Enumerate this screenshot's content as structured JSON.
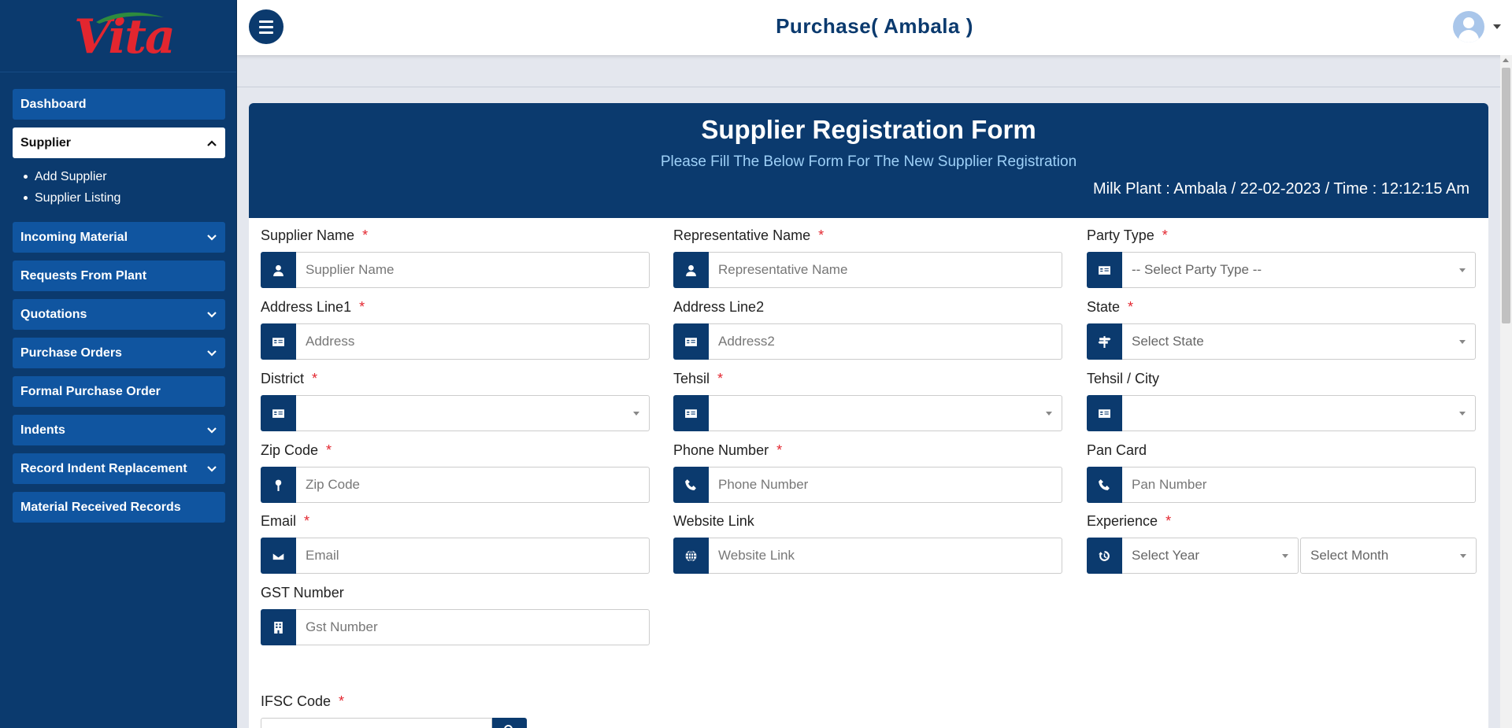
{
  "sidebar": {
    "logo_text": "Vita",
    "items": [
      {
        "label": "Dashboard"
      },
      {
        "label": "Supplier",
        "expanded": true,
        "subitems": [
          {
            "label": "Add Supplier"
          },
          {
            "label": "Supplier Listing"
          }
        ]
      },
      {
        "label": "Incoming Material"
      },
      {
        "label": "Requests From Plant"
      },
      {
        "label": "Quotations"
      },
      {
        "label": "Purchase Orders"
      },
      {
        "label": "Formal Purchase Order"
      },
      {
        "label": "Indents"
      },
      {
        "label": "Record Indent Replacement"
      },
      {
        "label": "Material Received Records"
      }
    ]
  },
  "header": {
    "title": "Purchase( Ambala )"
  },
  "form": {
    "title": "Supplier Registration Form",
    "subtitle": "Please Fill The Below Form For The New Supplier Registration",
    "plant_info": "Milk Plant : Ambala / 22-02-2023 / Time :  12:12:15 Am",
    "required_mark": "*",
    "fields": {
      "supplier_name": {
        "label": "Supplier Name",
        "placeholder": "Supplier Name"
      },
      "representative_name": {
        "label": "Representative Name",
        "placeholder": "Representative Name"
      },
      "party_type": {
        "label": "Party Type",
        "value": "-- Select Party Type --"
      },
      "address1": {
        "label": "Address Line1",
        "placeholder": "Address"
      },
      "address2": {
        "label": "Address Line2",
        "placeholder": "Address2"
      },
      "state": {
        "label": "State",
        "value": "Select State"
      },
      "district": {
        "label": "District",
        "value": ""
      },
      "tehsil": {
        "label": "Tehsil",
        "value": ""
      },
      "tehsil_city": {
        "label": "Tehsil / City",
        "value": ""
      },
      "zip": {
        "label": "Zip Code",
        "placeholder": "Zip Code"
      },
      "phone": {
        "label": "Phone Number",
        "placeholder": "Phone Number"
      },
      "pan": {
        "label": "Pan Card",
        "placeholder": "Pan Number"
      },
      "email": {
        "label": "Email",
        "placeholder": "Email"
      },
      "website": {
        "label": "Website Link",
        "placeholder": "Website Link"
      },
      "experience": {
        "label": "Experience",
        "year": "Select Year",
        "month": "Select Month"
      },
      "gst": {
        "label": "GST Number",
        "placeholder": "Gst Number"
      },
      "ifsc": {
        "label": "IFSC Code"
      }
    }
  },
  "colors": {
    "primary": "#0b3a6e",
    "nav_item": "#1055a0",
    "required": "#e3262f",
    "subtitle": "#9ed0f7"
  }
}
